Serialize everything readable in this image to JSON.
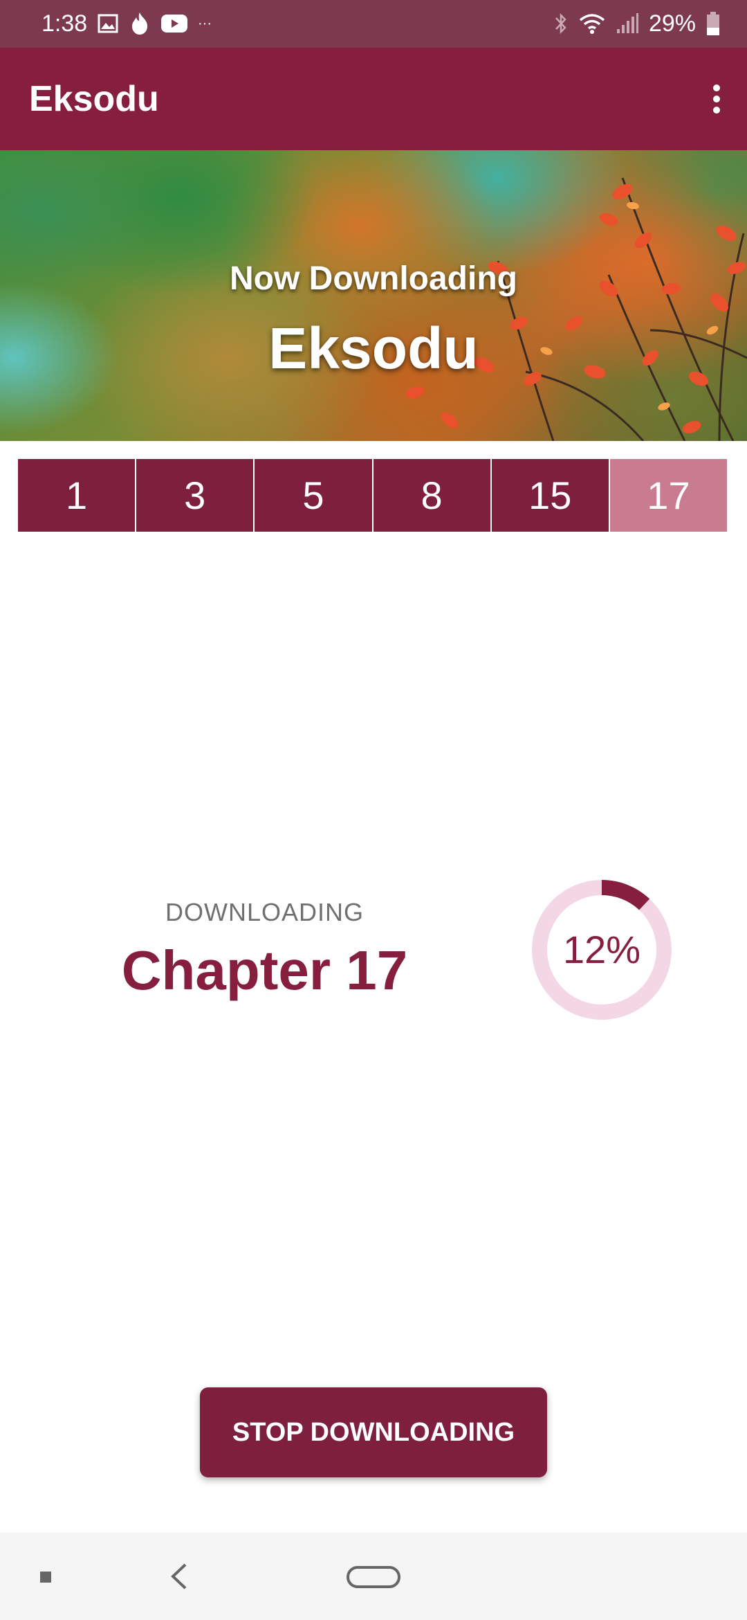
{
  "status_bar": {
    "time": "1:38",
    "left_icons": [
      "image-icon",
      "flame-icon",
      "youtube-icon",
      "more-notifications-icon"
    ],
    "right_icons": [
      "bluetooth-icon",
      "wifi-icon",
      "signal-icon",
      "battery-icon"
    ],
    "battery_percent": "29%"
  },
  "app_bar": {
    "title": "Eksodu",
    "menu_icon": "more-vert-icon"
  },
  "hero": {
    "subtitle": "Now Downloading",
    "title": "Eksodu"
  },
  "chapter_tabs": [
    {
      "label": "1",
      "active": false
    },
    {
      "label": "3",
      "active": false
    },
    {
      "label": "5",
      "active": false
    },
    {
      "label": "8",
      "active": false
    },
    {
      "label": "15",
      "active": false
    },
    {
      "label": "17",
      "active": true
    }
  ],
  "download": {
    "status_label": "DOWNLOADING",
    "chapter": "Chapter 17",
    "progress_text": "12%",
    "progress_value": 0.12
  },
  "stop_button": {
    "label": "STOP DOWNLOADING"
  },
  "colors": {
    "primary": "#861f3e",
    "tab_active": "#c97c8f",
    "ring_track": "#f3d7e4"
  },
  "nav_bar": {
    "icons": [
      "recent-apps-icon",
      "back-icon",
      "home-icon"
    ]
  }
}
